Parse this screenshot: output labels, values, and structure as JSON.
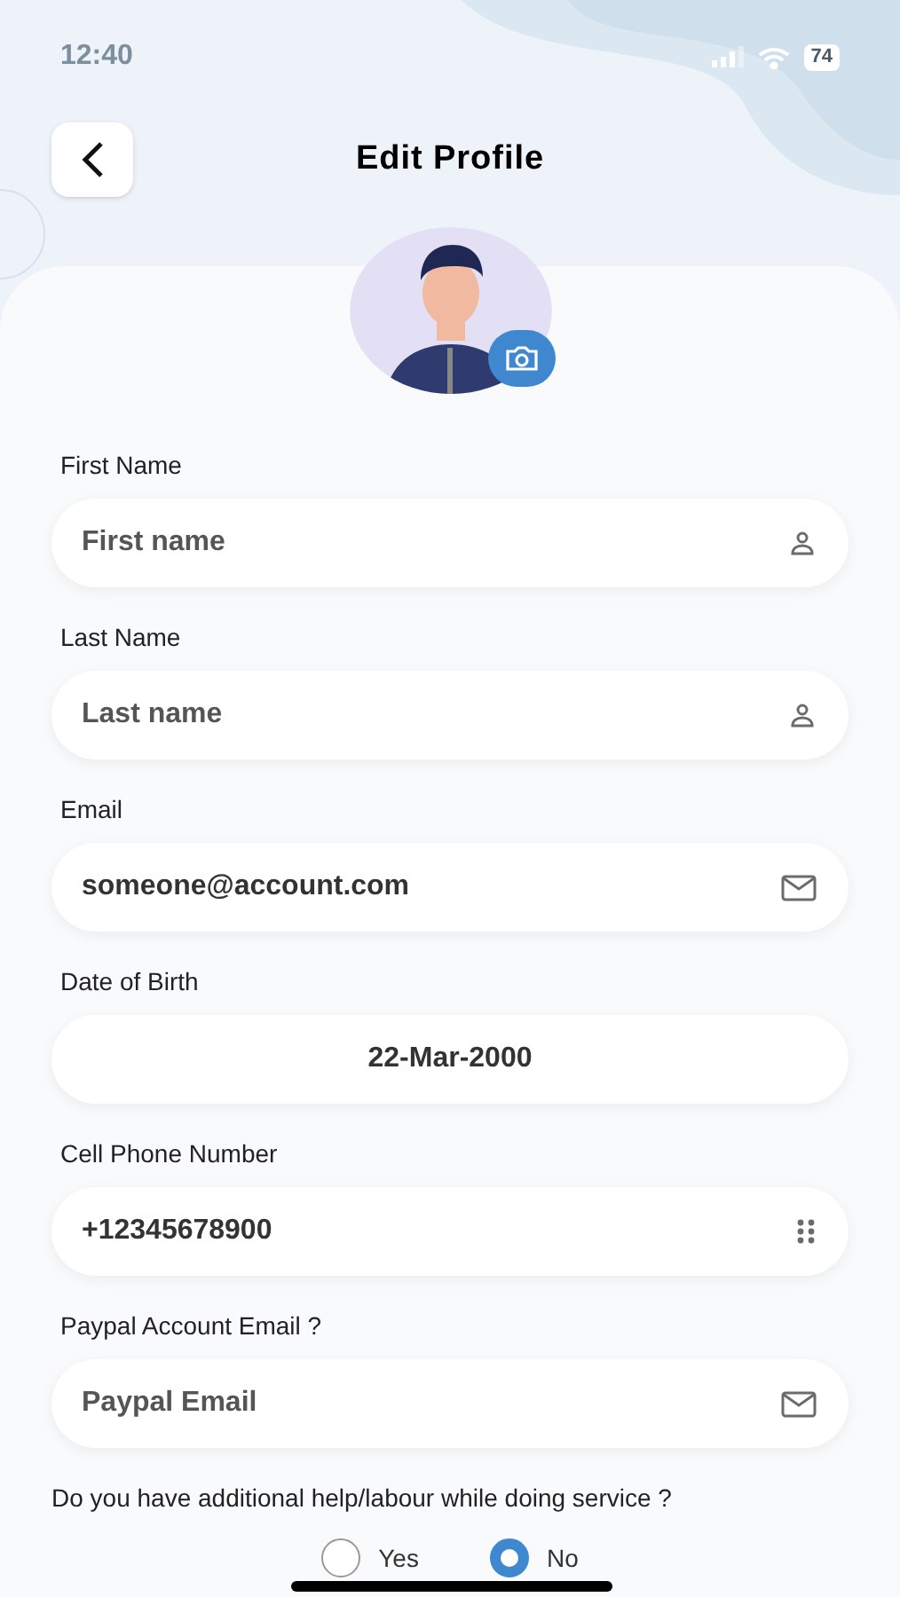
{
  "status_bar": {
    "time": "12:40",
    "battery": "74"
  },
  "header": {
    "title": "Edit Profile"
  },
  "fields": [
    {
      "label": "First Name",
      "placeholder": "First name",
      "kind": "person"
    },
    {
      "label": "Last Name",
      "placeholder": "Last name",
      "kind": "person"
    },
    {
      "label": "Email",
      "value": "someone@account.com",
      "kind": "mail"
    },
    {
      "label": "Date of Birth",
      "value": "22-Mar-2000",
      "kind": "date"
    },
    {
      "label": "Cell Phone Number",
      "value": "+12345678900",
      "kind": "phone"
    },
    {
      "label": "Paypal Account Email ?",
      "placeholder": "Paypal Email",
      "kind": "mail"
    }
  ],
  "question": {
    "text": "Do you have additional help/labour while doing service ?",
    "options": [
      {
        "label": "Yes",
        "selected": false
      },
      {
        "label": "No",
        "selected": true
      }
    ]
  }
}
